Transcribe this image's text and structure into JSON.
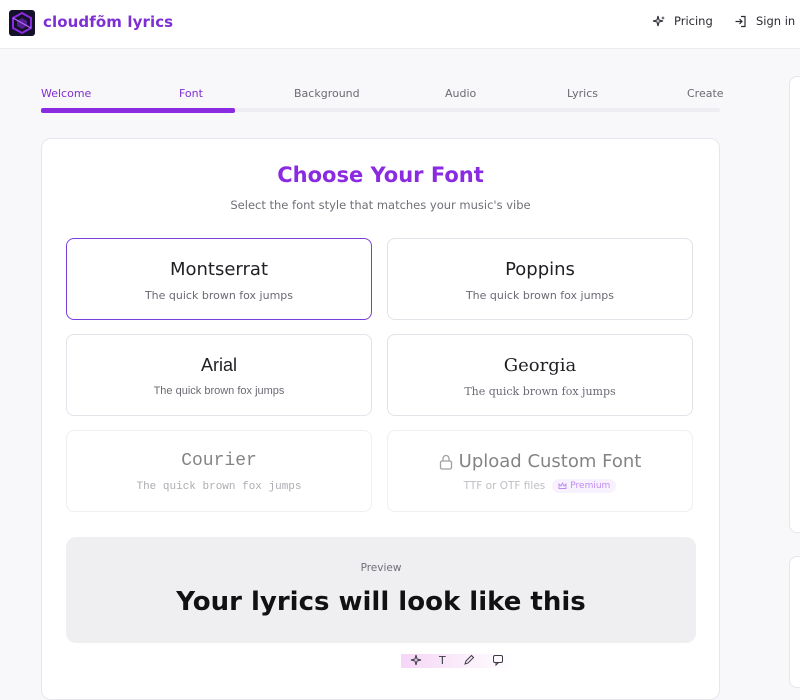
{
  "header": {
    "brand": "cloudfõm lyrics",
    "pricing_label": "Pricing",
    "signin_label": "Sign in"
  },
  "steps": {
    "items": [
      "Welcome",
      "Font",
      "Background",
      "Audio",
      "Lyrics",
      "Create"
    ],
    "current_index": 1,
    "progress_fraction": 0.286
  },
  "card": {
    "title": "Choose Your Font",
    "subtitle": "Select the font style that matches your music's vibe"
  },
  "fonts": [
    {
      "name": "Montserrat",
      "sample": "The quick brown fox jumps",
      "selected": true
    },
    {
      "name": "Poppins",
      "sample": "The quick brown fox jumps",
      "selected": false
    },
    {
      "name": "Arial",
      "sample": "The quick brown fox jumps",
      "selected": false
    },
    {
      "name": "Georgia",
      "sample": "The quick brown fox jumps",
      "selected": false
    },
    {
      "name": "Courier",
      "sample": "The quick brown fox jumps",
      "selected": false
    }
  ],
  "upload": {
    "label": "Upload Custom Font",
    "sub": "TTF or OTF files",
    "badge": "Premium",
    "icon": "lock-icon"
  },
  "preview": {
    "label": "Preview",
    "text": "Your lyrics will look like this"
  },
  "toolbar": {
    "icons": [
      "sparkle-icon",
      "text-icon",
      "pen-icon",
      "comment-icon"
    ],
    "text_glyph": "T"
  },
  "colors": {
    "accent": "#8a2be2",
    "brand_text": "#7e2fd4",
    "selected_border": "#7a3ee0",
    "badge_bg": "#f3e8ff"
  }
}
